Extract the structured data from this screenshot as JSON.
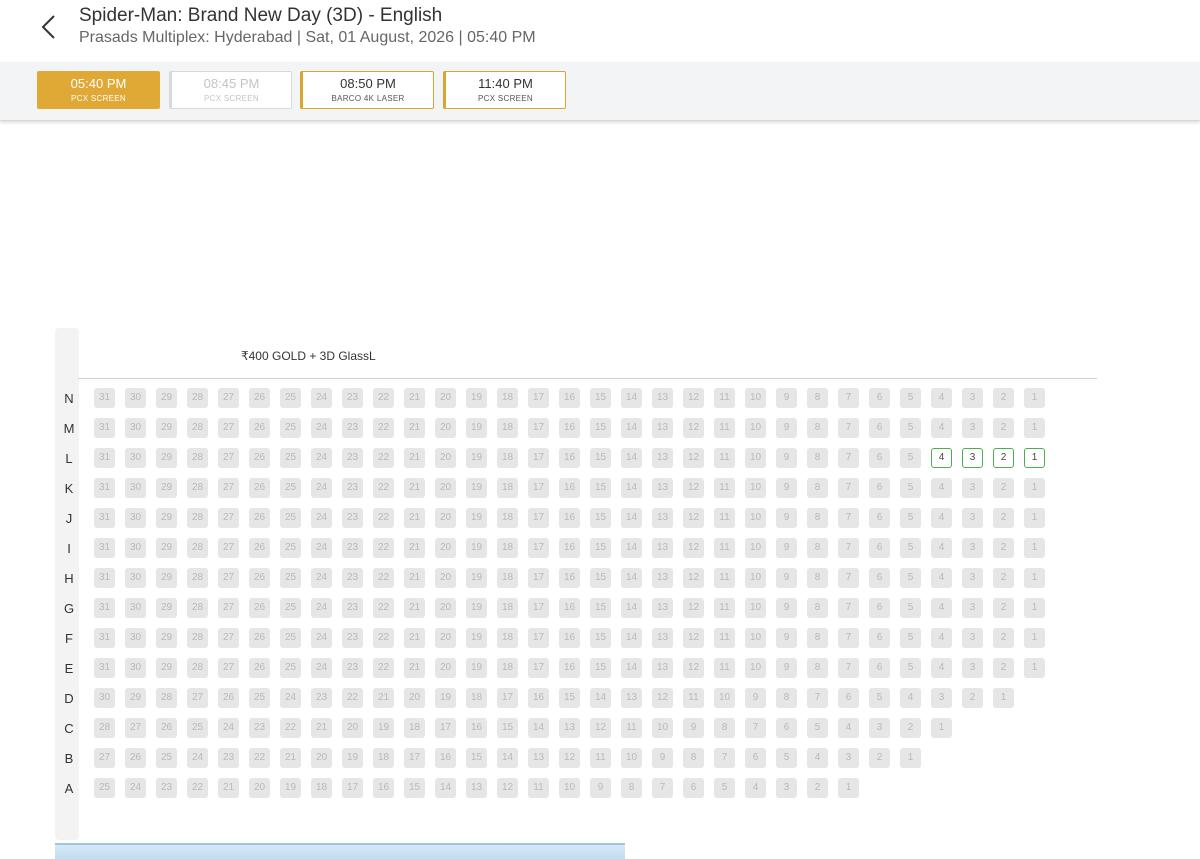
{
  "header": {
    "title": "Spider-Man: Brand New Day (3D) - English",
    "subtitle": "Prasads Multiplex: Hyderabad | Sat, 01 August, 2026 | 05:40 PM"
  },
  "showtimes": [
    {
      "time": "05:40 PM",
      "screen": "PCX SCREEN",
      "state": "selected"
    },
    {
      "time": "08:45 PM",
      "screen": "PCX SCREEN",
      "state": "disabled"
    },
    {
      "time": "08:50 PM",
      "screen": "BARCO 4K LASER",
      "state": "available"
    },
    {
      "time": "11:40 PM",
      "screen": "PCX SCREEN",
      "state": "available"
    }
  ],
  "seat_layout": {
    "category": "₹400 GOLD + 3D GlassL",
    "rows": [
      {
        "label": "N",
        "max": 31,
        "available": []
      },
      {
        "label": "M",
        "max": 31,
        "available": []
      },
      {
        "label": "L",
        "max": 31,
        "available": [
          4,
          3,
          2,
          1
        ]
      },
      {
        "label": "K",
        "max": 31,
        "available": []
      },
      {
        "label": "J",
        "max": 31,
        "available": []
      },
      {
        "label": "I",
        "max": 31,
        "available": []
      },
      {
        "label": "H",
        "max": 31,
        "available": []
      },
      {
        "label": "G",
        "max": 31,
        "available": []
      },
      {
        "label": "F",
        "max": 31,
        "available": []
      },
      {
        "label": "E",
        "max": 31,
        "available": []
      },
      {
        "label": "D",
        "max": 30,
        "available": []
      },
      {
        "label": "C",
        "max": 28,
        "available": []
      },
      {
        "label": "B",
        "max": 27,
        "available": []
      },
      {
        "label": "A",
        "max": 25,
        "available": []
      }
    ]
  },
  "colors": {
    "accent": "#e0a935",
    "available_border": "#4caf50",
    "sold_seat": "#e6e6e6"
  }
}
